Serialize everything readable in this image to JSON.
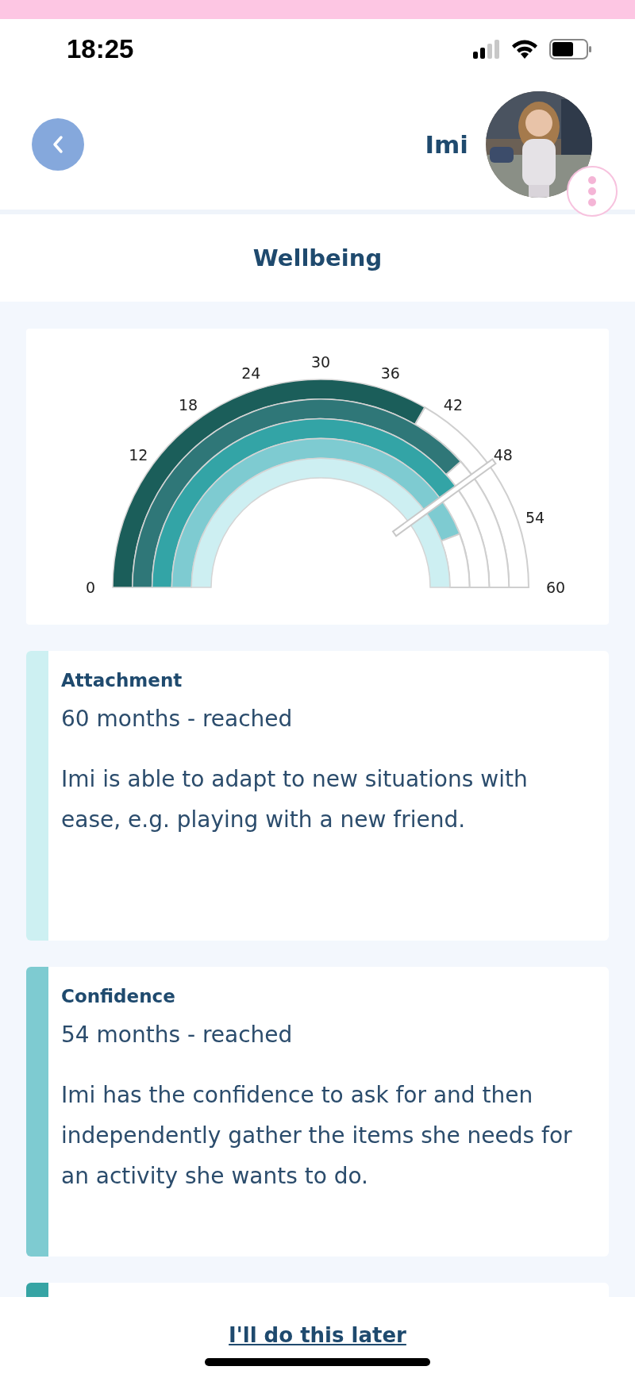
{
  "status_bar": {
    "time": "18:25"
  },
  "header": {
    "name": "Imi"
  },
  "title": "Wellbeing",
  "gauge": {
    "scale_labels": [
      "0",
      "12",
      "18",
      "24",
      "30",
      "36",
      "42",
      "48",
      "54",
      "60"
    ]
  },
  "cards": [
    {
      "title": "Attachment",
      "status": "60 months - reached",
      "text": "Imi is able to adapt to new situations with ease, e.g. playing with a new friend.",
      "color": "#cdf0f2"
    },
    {
      "title": "Confidence",
      "status": "54 months - reached",
      "text": "Imi has the confidence to ask for and then independently gather the items she needs for an activity she wants to do.",
      "color": "#7ecbd1"
    },
    {
      "color": "#36a4a4"
    }
  ],
  "footer": {
    "link": "I'll do this later"
  }
}
